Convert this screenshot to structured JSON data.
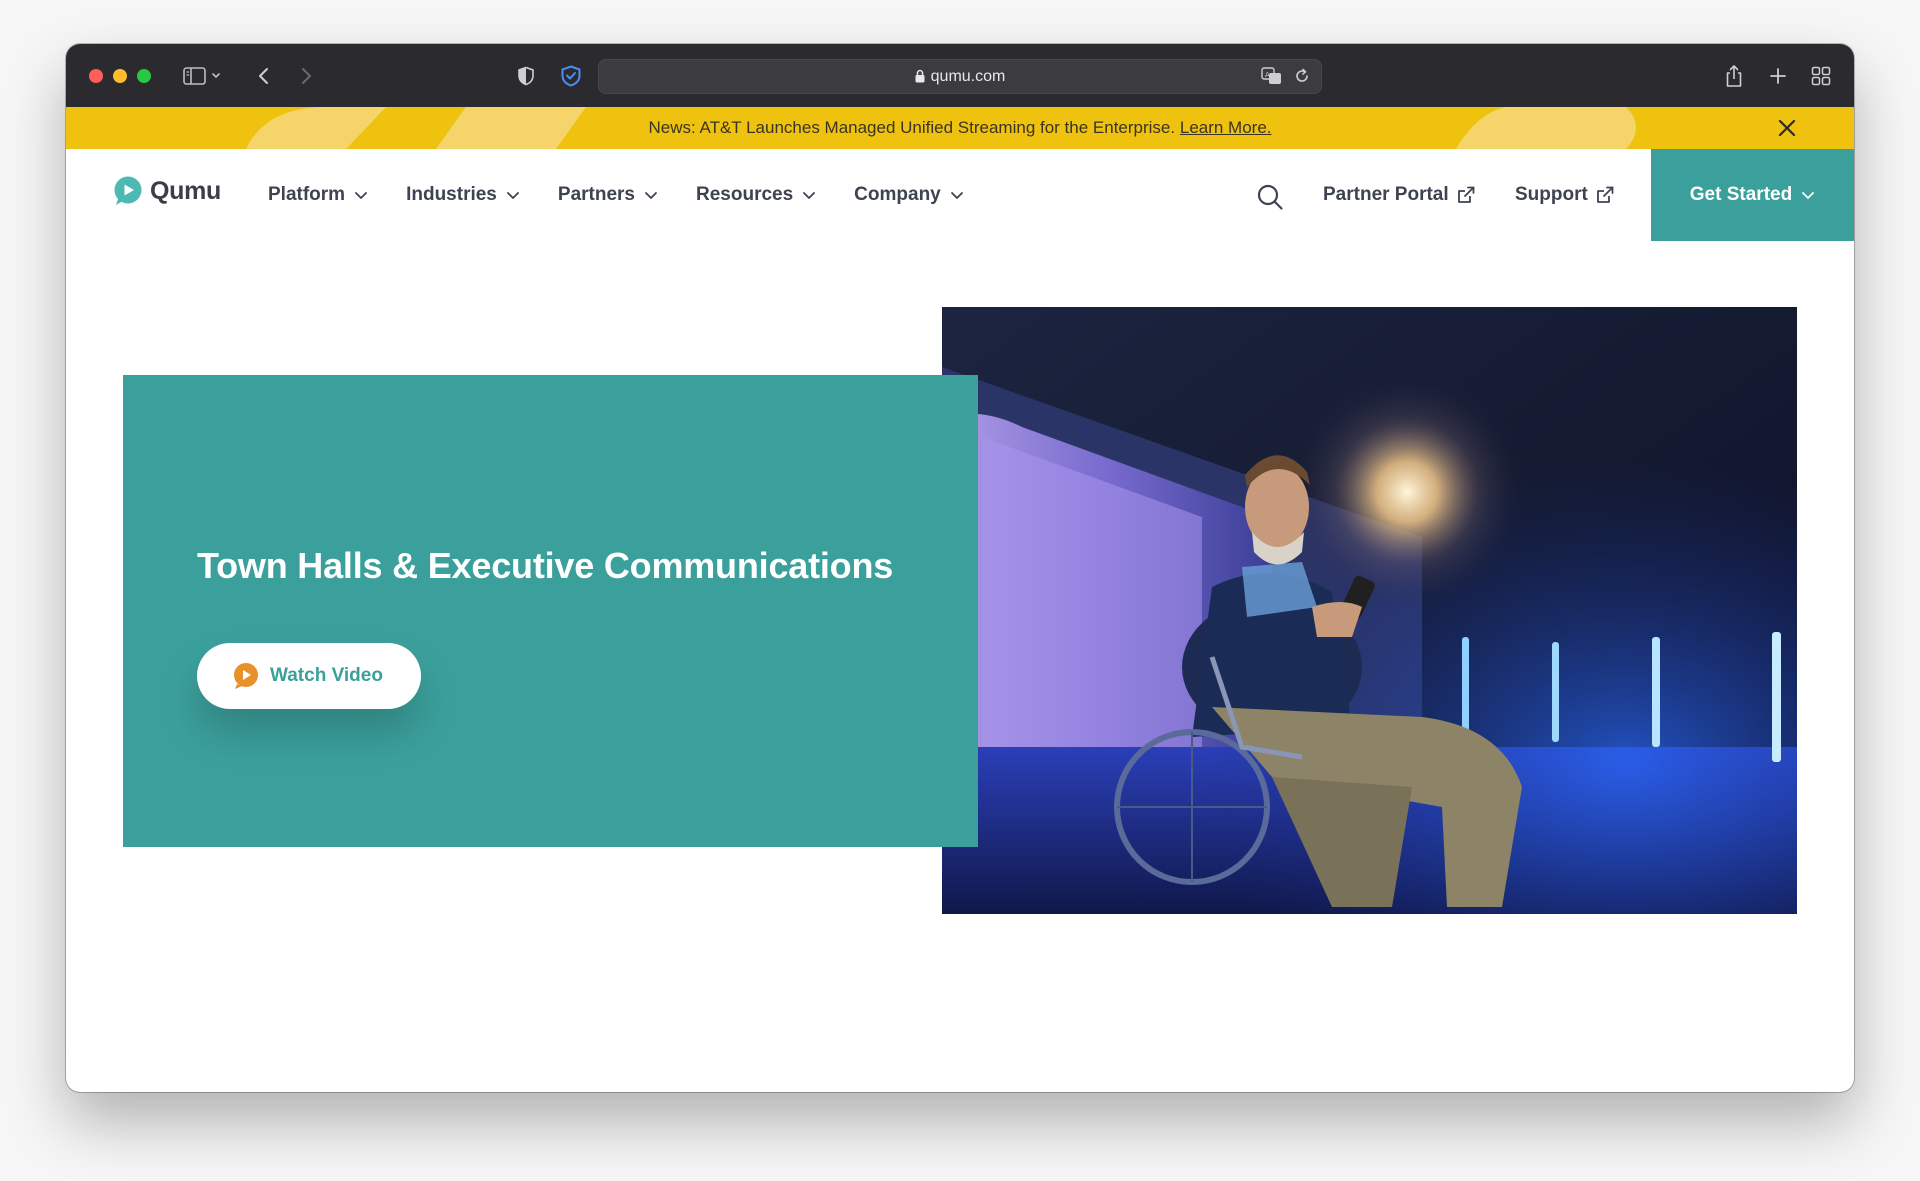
{
  "browser": {
    "url": "qumu.com"
  },
  "announcement": {
    "text": "News: AT&T Launches Managed Unified Streaming for the Enterprise.",
    "link": "Learn More."
  },
  "nav": {
    "logo": "Qumu",
    "menu": [
      {
        "label": "Platform"
      },
      {
        "label": "Industries"
      },
      {
        "label": "Partners"
      },
      {
        "label": "Resources"
      },
      {
        "label": "Company"
      }
    ],
    "partner_portal": "Partner Portal",
    "support": "Support",
    "cta": "Get Started"
  },
  "hero": {
    "title": "Town Halls & Executive Communications",
    "button": "Watch Video"
  },
  "colors": {
    "brand_teal": "#3ba09c",
    "banner_yellow": "#efc20f",
    "accent_orange": "#e8902a",
    "chrome_dark": "#2b2a2e"
  }
}
